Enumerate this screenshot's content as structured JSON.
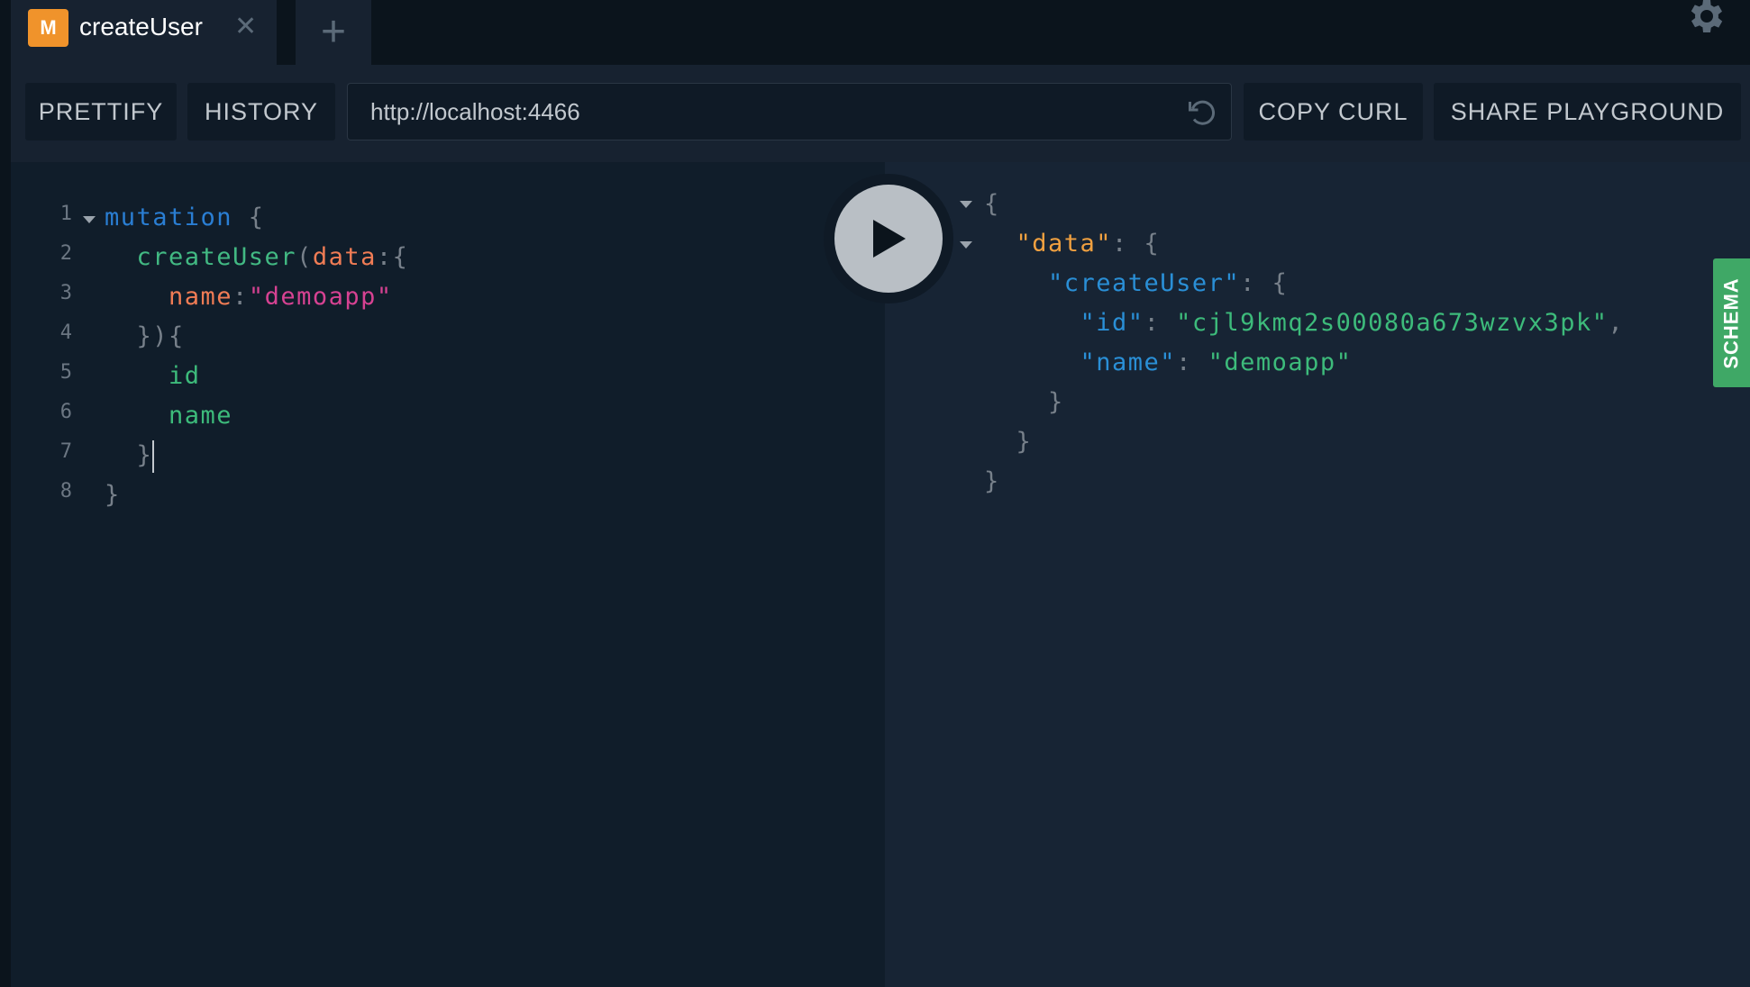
{
  "tabs": [
    {
      "badge": "M",
      "title": "createUser",
      "close": "✕"
    }
  ],
  "add_tab": "+",
  "toolbar": {
    "prettify": "PRETTIFY",
    "history": "HISTORY",
    "url": "http://localhost:4466",
    "copy_curl": "COPY CURL",
    "share": "SHARE PLAYGROUND"
  },
  "editor": {
    "line_numbers": [
      "1",
      "2",
      "3",
      "4",
      "5",
      "6",
      "7",
      "8"
    ],
    "lines": [
      [
        {
          "t": "mutation",
          "c": "kw"
        },
        {
          "t": " {",
          "c": "pun"
        }
      ],
      [
        {
          "t": "  createUser",
          "c": "fn"
        },
        {
          "t": "(",
          "c": "pun"
        },
        {
          "t": "data",
          "c": "arg"
        },
        {
          "t": ":{",
          "c": "pun"
        }
      ],
      [
        {
          "t": "    name",
          "c": "arg"
        },
        {
          "t": ":",
          "c": "pun"
        },
        {
          "t": "\"demoapp\"",
          "c": "str"
        }
      ],
      [
        {
          "t": "  }){",
          "c": "pun"
        }
      ],
      [
        {
          "t": "    id",
          "c": "fld"
        }
      ],
      [
        {
          "t": "    name",
          "c": "fld"
        }
      ],
      [
        {
          "t": "  }",
          "c": "pun"
        }
      ],
      [
        {
          "t": "}",
          "c": "pun"
        }
      ]
    ]
  },
  "result": {
    "lines": [
      [
        {
          "t": "{",
          "c": "pun"
        }
      ],
      [
        {
          "t": "  \"data\"",
          "c": "jd"
        },
        {
          "t": ": {",
          "c": "pun"
        }
      ],
      [
        {
          "t": "    \"createUser\"",
          "c": "jk"
        },
        {
          "t": ": {",
          "c": "pun"
        }
      ],
      [
        {
          "t": "      \"id\"",
          "c": "jk"
        },
        {
          "t": ": ",
          "c": "pun"
        },
        {
          "t": "\"cjl9kmq2s00080a673wzvx3pk\"",
          "c": "js"
        },
        {
          "t": ",",
          "c": "pun"
        }
      ],
      [
        {
          "t": "      \"name\"",
          "c": "jk"
        },
        {
          "t": ": ",
          "c": "pun"
        },
        {
          "t": "\"demoapp\"",
          "c": "js"
        }
      ],
      [
        {
          "t": "    }",
          "c": "pun"
        }
      ],
      [
        {
          "t": "  }",
          "c": "pun"
        }
      ],
      [
        {
          "t": "}",
          "c": "pun"
        }
      ]
    ]
  },
  "schema_tab": "SCHEMA",
  "icons": {
    "settings": "gear-icon",
    "reload": "reload-icon",
    "run": "play-icon"
  },
  "colors": {
    "badge": "#f0932b",
    "schema": "#3fa866",
    "keyword": "#2a7ed3",
    "string": "#d64292"
  }
}
